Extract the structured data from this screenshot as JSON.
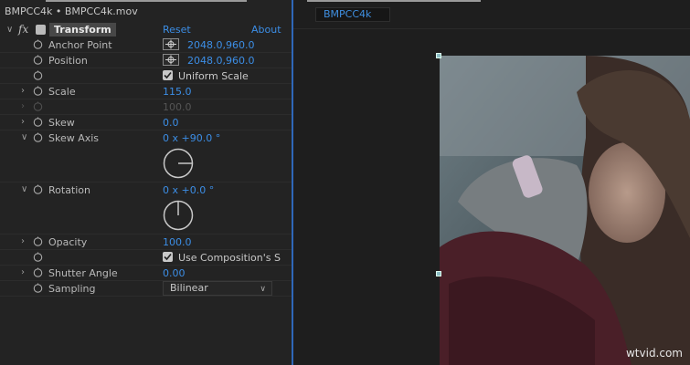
{
  "effects_panel": {
    "title": "BMPCC4k • BMPCC4k.mov",
    "effect": {
      "fx_label": "fx",
      "name": "Transform",
      "reset": "Reset",
      "about": "About"
    },
    "properties": {
      "anchor_point": {
        "label": "Anchor Point",
        "value": "2048.0,960.0"
      },
      "position": {
        "label": "Position",
        "value": "2048.0,960.0"
      },
      "uniform_scale": {
        "label": "Uniform Scale",
        "checked": true
      },
      "scale": {
        "label": "Scale",
        "value": "115.0"
      },
      "scale_disabled": {
        "value": "100.0"
      },
      "skew": {
        "label": "Skew",
        "value": "0.0"
      },
      "skew_axis": {
        "label": "Skew Axis",
        "value": "0 x +90.0 °"
      },
      "rotation": {
        "label": "Rotation",
        "value": "0 x +0.0 °"
      },
      "opacity": {
        "label": "Opacity",
        "value": "100.0"
      },
      "use_comp_shutter": {
        "label": "Use Composition's S",
        "checked": true
      },
      "shutter_angle": {
        "label": "Shutter Angle",
        "value": "0.00"
      },
      "sampling": {
        "label": "Sampling",
        "value": "Bilinear"
      }
    }
  },
  "composition_panel": {
    "tab_label": "BMPCC4k",
    "watermark": "wtvid.com"
  }
}
